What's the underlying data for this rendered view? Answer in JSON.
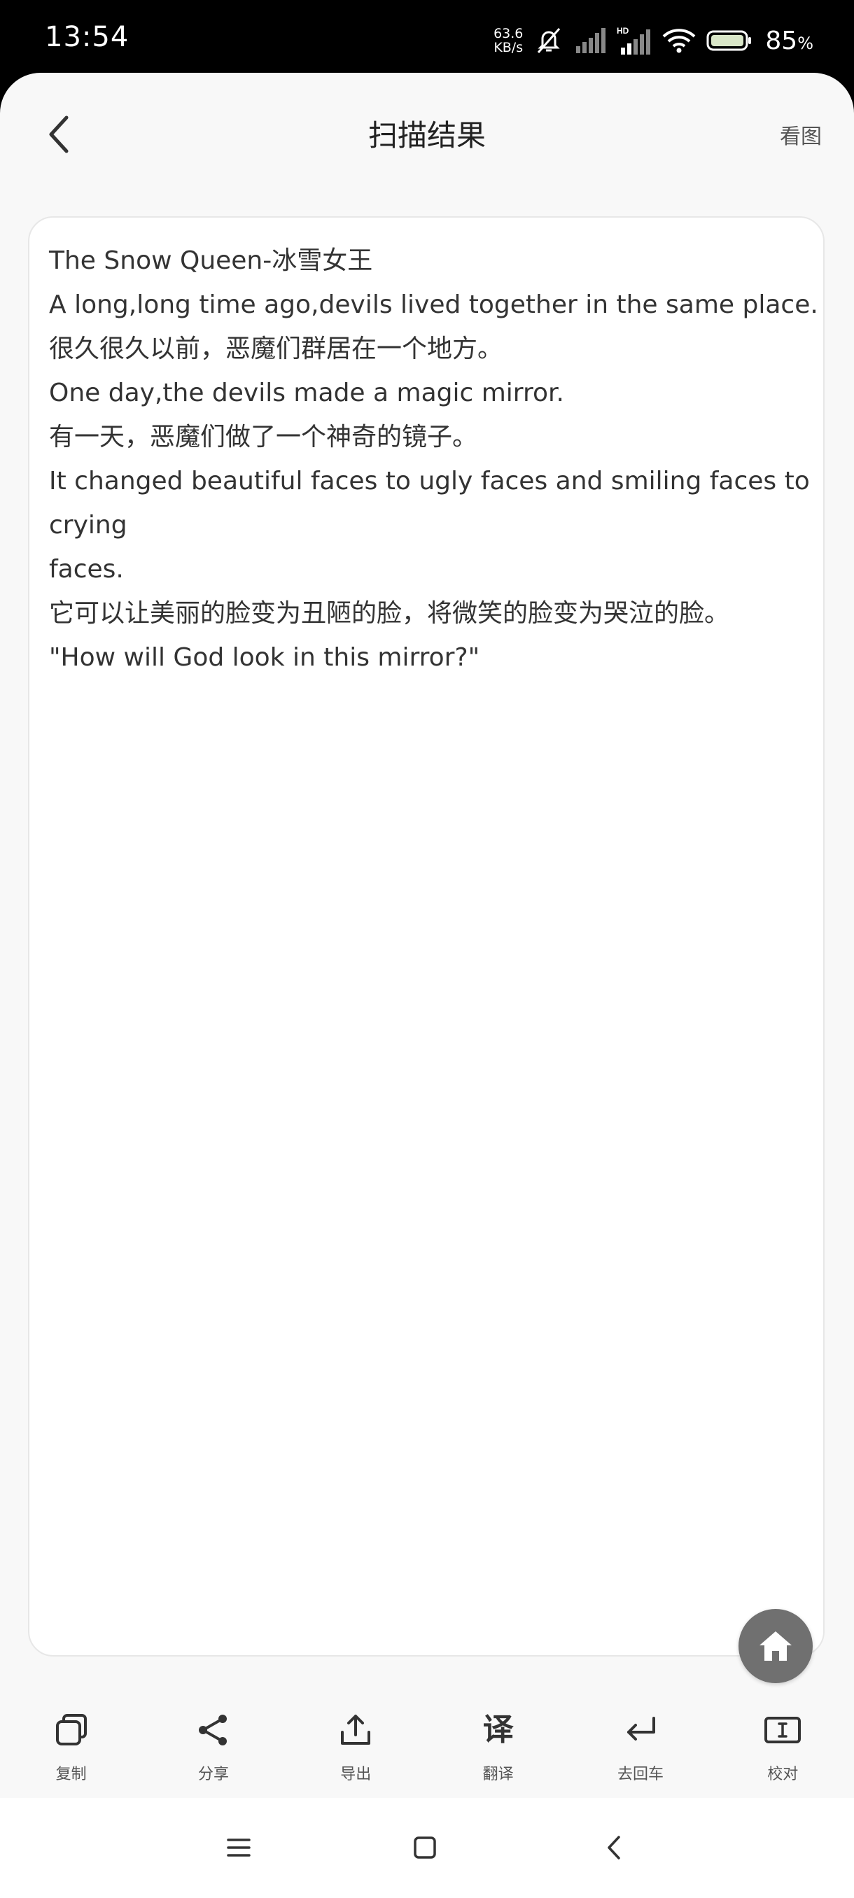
{
  "status_bar": {
    "time": "13:54",
    "net_speed_value": "63.6",
    "net_speed_unit": "KB/s",
    "battery_percent": "85",
    "battery_unit": "%",
    "icons": [
      "mute-icon",
      "signal-icon",
      "hd-signal-icon",
      "wifi-icon",
      "battery-icon"
    ]
  },
  "header": {
    "title": "扫描结果",
    "view_image_label": "看图"
  },
  "content": {
    "lines": [
      "The Snow Queen-冰雪女王",
      "A long,long time ago,devils lived together in the same place.",
      "很久很久以前，恶魔们群居在一个地方。",
      "One day,the devils made a magic mirror.",
      "有一天，恶魔们做了一个神奇的镜子。",
      "It changed beautiful faces to ugly faces and smiling faces to",
      "crying",
      "faces.",
      "它可以让美丽的脸变为丑陋的脸，将微笑的脸变为哭泣的脸。",
      "\"How will God look in this mirror?\""
    ]
  },
  "toolbar": {
    "items": [
      {
        "label": "复制",
        "icon": "copy-icon"
      },
      {
        "label": "分享",
        "icon": "share-icon"
      },
      {
        "label": "导出",
        "icon": "export-icon"
      },
      {
        "label": "翻译",
        "icon": "translate-icon",
        "glyph": "译"
      },
      {
        "label": "去回车",
        "icon": "remove-return-icon"
      },
      {
        "label": "校对",
        "icon": "proofread-icon"
      }
    ]
  },
  "colors": {
    "background": "#f8f8f8",
    "card": "#ffffff",
    "text": "#333333",
    "fab": "#707070"
  }
}
